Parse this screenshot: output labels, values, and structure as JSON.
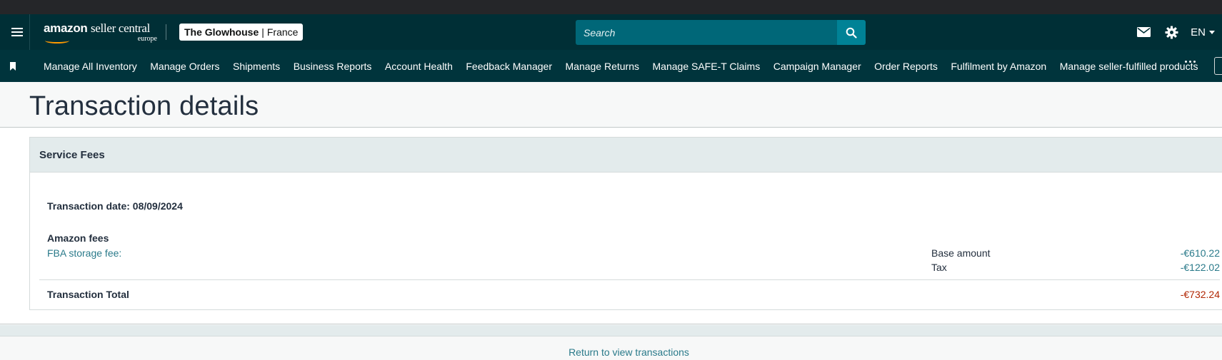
{
  "header": {
    "logo": {
      "brand": "amazon",
      "product": "seller central",
      "region": "europe"
    },
    "store": {
      "name": "The Glowhouse",
      "separator": "|",
      "marketplace": "France"
    },
    "search": {
      "placeholder": "Search",
      "value": ""
    },
    "language": "EN",
    "icons": [
      "menu-icon",
      "search-icon",
      "mail-icon",
      "gear-icon",
      "chevron-down-icon"
    ]
  },
  "nav": {
    "items": [
      "Manage All Inventory",
      "Manage Orders",
      "Shipments",
      "Business Reports",
      "Account Health",
      "Feedback Manager",
      "Manage Returns",
      "Manage SAFE-T Claims",
      "Campaign Manager",
      "Order Reports",
      "Fulfilment by Amazon",
      "Manage seller-fulfilled products"
    ]
  },
  "page": {
    "title": "Transaction details"
  },
  "card": {
    "title": "Service Fees",
    "transaction_date": "Transaction date: 08/09/2024",
    "fees_heading": "Amazon fees",
    "fee_name": "FBA storage fee:",
    "breakdown": [
      {
        "label": "Base amount",
        "value": "-€610.22"
      },
      {
        "label": "Tax",
        "value": "-€122.02"
      }
    ],
    "total_label": "Transaction Total",
    "total_value": "-€732.24"
  },
  "footer": {
    "return_link": "Return to view transactions"
  },
  "colors": {
    "topbar": "#002f36",
    "navbar": "#00343c",
    "search_field": "#006778",
    "search_button": "#008296",
    "link": "#2a7a8a",
    "negative_total": "#b12704",
    "card_header": "#e3ebec"
  }
}
